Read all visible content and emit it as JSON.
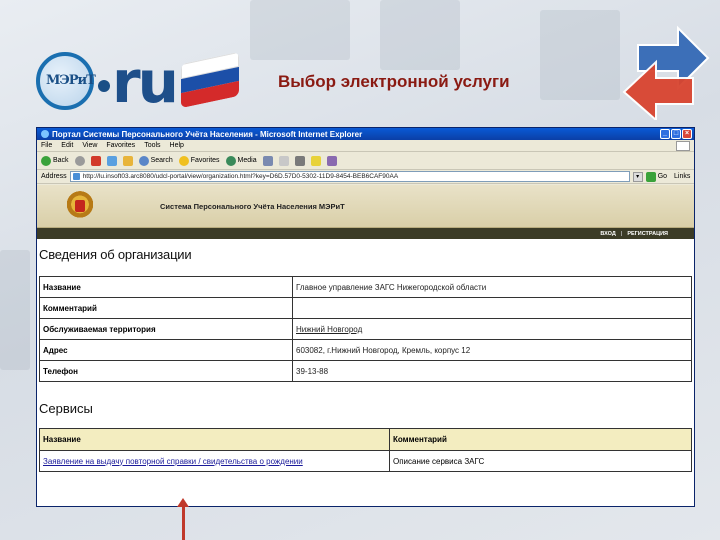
{
  "slide": {
    "logo_text": "МЭРиТ",
    "logo_suffix": "ru",
    "title": "Выбор электронной услуги"
  },
  "browser": {
    "window_title": "Портал Системы Персонального Учёта Населения - Microsoft Internet Explorer",
    "menu": [
      "File",
      "Edit",
      "View",
      "Favorites",
      "Tools",
      "Help"
    ],
    "toolbar": {
      "back": "Back",
      "search": "Search",
      "favorites": "Favorites",
      "media": "Media"
    },
    "address_label": "Address",
    "address_url": "http://lu.insoft03.arc8080/udcl-portal/view/organization.html?key=D6D.57D0-5302-11D9-8454-BEB6CAF90AA",
    "go_label": "Go",
    "links_label": "Links"
  },
  "site": {
    "name": "Система Персонального Учёта Населения МЭРиТ",
    "nav_login": "ВХОД",
    "nav_separator": "|",
    "nav_register": "РЕГИСТРАЦИЯ"
  },
  "organization": {
    "section_title": "Сведения об организации",
    "rows": [
      {
        "label": "Название",
        "value": "Главное управление ЗАГС Нижегородской области",
        "is_link": false
      },
      {
        "label": "Комментарий",
        "value": "",
        "is_link": false
      },
      {
        "label": "Обслуживаемая территория",
        "value": "Нижний Новгород",
        "is_link": true
      },
      {
        "label": "Адрес",
        "value": "603082, г.Нижний Новгород, Кремль, корпус 12",
        "is_link": false
      },
      {
        "label": "Телефон",
        "value": "39-13-88",
        "is_link": false
      }
    ]
  },
  "services": {
    "section_title": "Сервисы",
    "headers": {
      "name": "Название",
      "comment": "Комментарий"
    },
    "items": [
      {
        "name": "Заявление на выдачу повторной справки / свидетельства о рождении",
        "comment": "Описание сервиса ЗАГС"
      }
    ]
  },
  "colors": {
    "accent_title": "#8a1a12",
    "pointer": "#c0392b",
    "table_header": "#f3edc0",
    "site_nav": "#3b3b26"
  }
}
